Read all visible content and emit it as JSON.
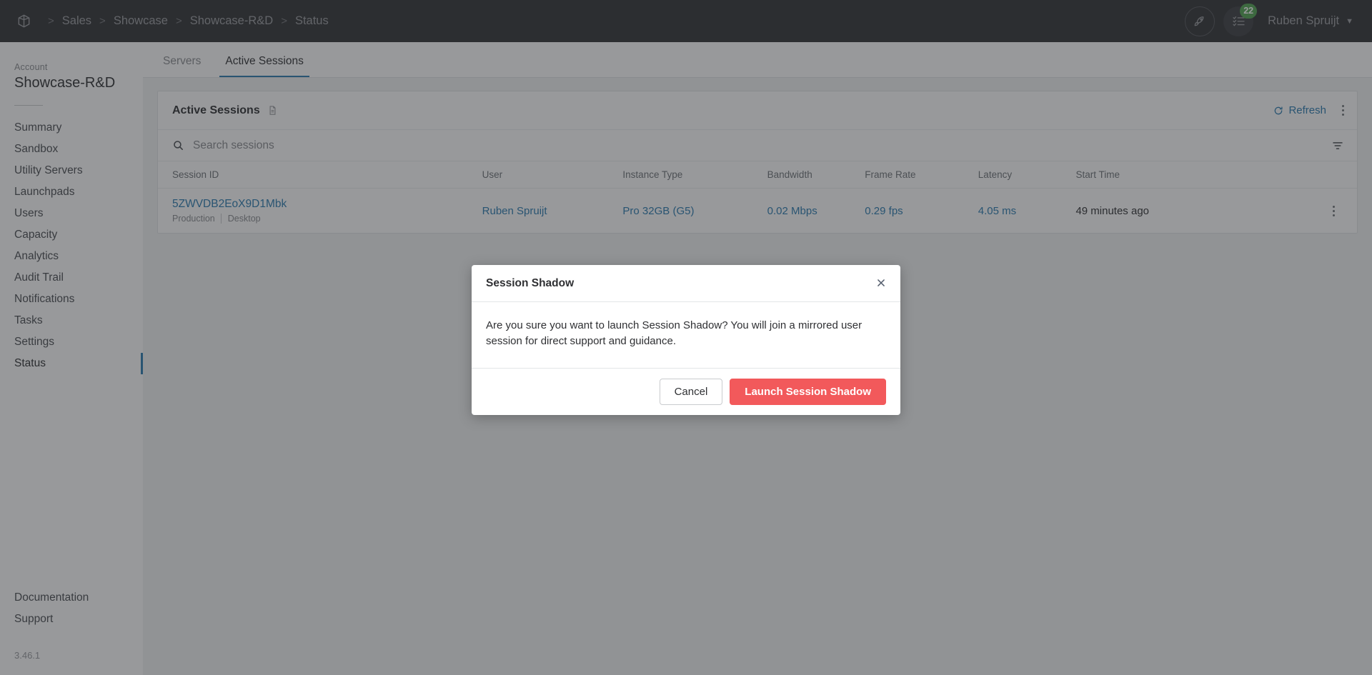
{
  "topbar": {
    "logo_icon": "cube-icon",
    "breadcrumb": [
      "Sales",
      "Showcase",
      "Showcase-R&D",
      "Status"
    ],
    "separator": ">",
    "rocket_icon": "rocket-icon",
    "tasks_icon": "checklist-icon",
    "tasks_badge": "22",
    "user_name": "Ruben Spruijt",
    "user_chevron": "chevron-down-icon"
  },
  "sidebar": {
    "account_label": "Account",
    "account_name": "Showcase-R&D",
    "items": [
      {
        "label": "Summary",
        "active": false
      },
      {
        "label": "Sandbox",
        "active": false
      },
      {
        "label": "Utility Servers",
        "active": false
      },
      {
        "label": "Launchpads",
        "active": false
      },
      {
        "label": "Users",
        "active": false
      },
      {
        "label": "Capacity",
        "active": false
      },
      {
        "label": "Analytics",
        "active": false
      },
      {
        "label": "Audit Trail",
        "active": false
      },
      {
        "label": "Notifications",
        "active": false
      },
      {
        "label": "Tasks",
        "active": false
      },
      {
        "label": "Settings",
        "active": false
      },
      {
        "label": "Status",
        "active": true
      }
    ],
    "documentation": "Documentation",
    "support": "Support",
    "version": "3.46.1"
  },
  "tabs": [
    {
      "label": "Servers",
      "active": false
    },
    {
      "label": "Active Sessions",
      "active": true
    }
  ],
  "card": {
    "title": "Active Sessions",
    "title_icon": "document-icon",
    "refresh_label": "Refresh",
    "refresh_icon": "refresh-icon",
    "menu_icon": "kebab-menu-icon",
    "search_placeholder": "Search sessions",
    "search_value": "",
    "search_icon": "search-icon",
    "filter_icon": "funnel-icon"
  },
  "table": {
    "columns": [
      "Session ID",
      "User",
      "Instance Type",
      "Bandwidth",
      "Frame Rate",
      "Latency",
      "Start Time"
    ],
    "rows": [
      {
        "session_id": "5ZWVDB2EoX9D1Mbk",
        "tag_env": "Production",
        "tag_type": "Desktop",
        "user": "Ruben Spruijt",
        "instance_type": "Pro 32GB (G5)",
        "bandwidth": "0.02 Mbps",
        "frame_rate": "0.29 fps",
        "latency": "4.05 ms",
        "start_time": "49 minutes ago",
        "row_menu_icon": "kebab-menu-icon"
      }
    ]
  },
  "modal": {
    "title": "Session Shadow",
    "close_icon": "close-icon",
    "body": "Are you sure you want to launch Session Shadow? You will join a mirrored user session for direct support and guidance.",
    "cancel_label": "Cancel",
    "confirm_label": "Launch Session Shadow"
  },
  "colors": {
    "topbar_bg": "#313235",
    "accent_blue": "#2b7cb0",
    "danger_red": "#f2595b",
    "badge_green": "#51a351"
  }
}
